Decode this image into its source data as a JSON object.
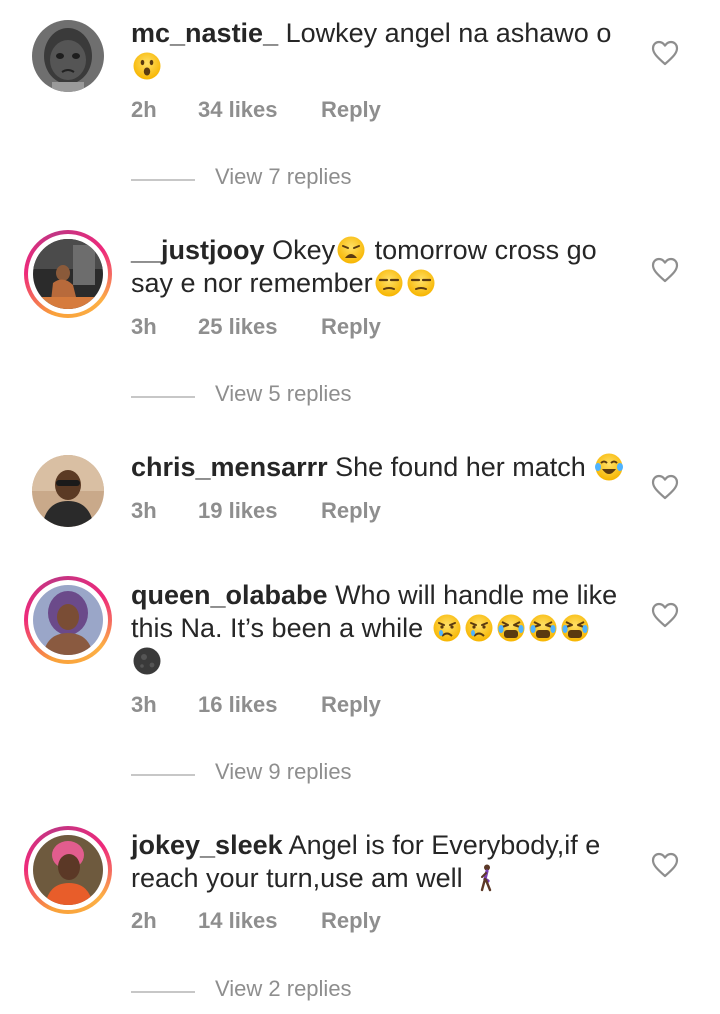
{
  "comments": [
    {
      "username": "mc_nastie_",
      "text": "Lowkey angel na ashawo o",
      "time": "2h",
      "likes": "34 likes",
      "reply": "Reply",
      "view_replies": "View 7 replies"
    },
    {
      "username": "__justjooy",
      "text_a": "Okey",
      "text_b": " tomorrow cross go say e nor remember",
      "time": "3h",
      "likes": "25 likes",
      "reply": "Reply",
      "view_replies": "View 5 replies"
    },
    {
      "username": "chris_mensarrr",
      "text": "She found her match",
      "time": "3h",
      "likes": "19 likes",
      "reply": "Reply"
    },
    {
      "username": "queen_olababe",
      "text": "Who will handle me like this Na. It’s been a while",
      "time": "3h",
      "likes": "16 likes",
      "reply": "Reply",
      "view_replies": "View 9 replies"
    },
    {
      "username": "jokey_sleek",
      "text": "Angel is for Everybody,if e reach your turn,use am well",
      "time": "2h",
      "likes": "14 likes",
      "reply": "Reply",
      "view_replies": "View 2 replies"
    }
  ],
  "icons": {
    "like": "heart-outline-icon",
    "emoji_surprised": "surprised-face-emoji",
    "emoji_weary": "weary-face-emoji",
    "emoji_unamused": "unamused-face-emoji",
    "emoji_joy": "tears-of-joy-emoji",
    "emoji_crying": "crying-face-emoji",
    "emoji_tired": "tired-face-emoji",
    "emoji_new_moon": "new-moon-face-emoji",
    "emoji_walking": "person-walking-emoji"
  },
  "colors": {
    "text": "#262626",
    "meta": "#8e8e8e",
    "divider": "#c7c7c7",
    "story_ring_start": "#f9a13a",
    "story_ring_end": "#c13584"
  }
}
